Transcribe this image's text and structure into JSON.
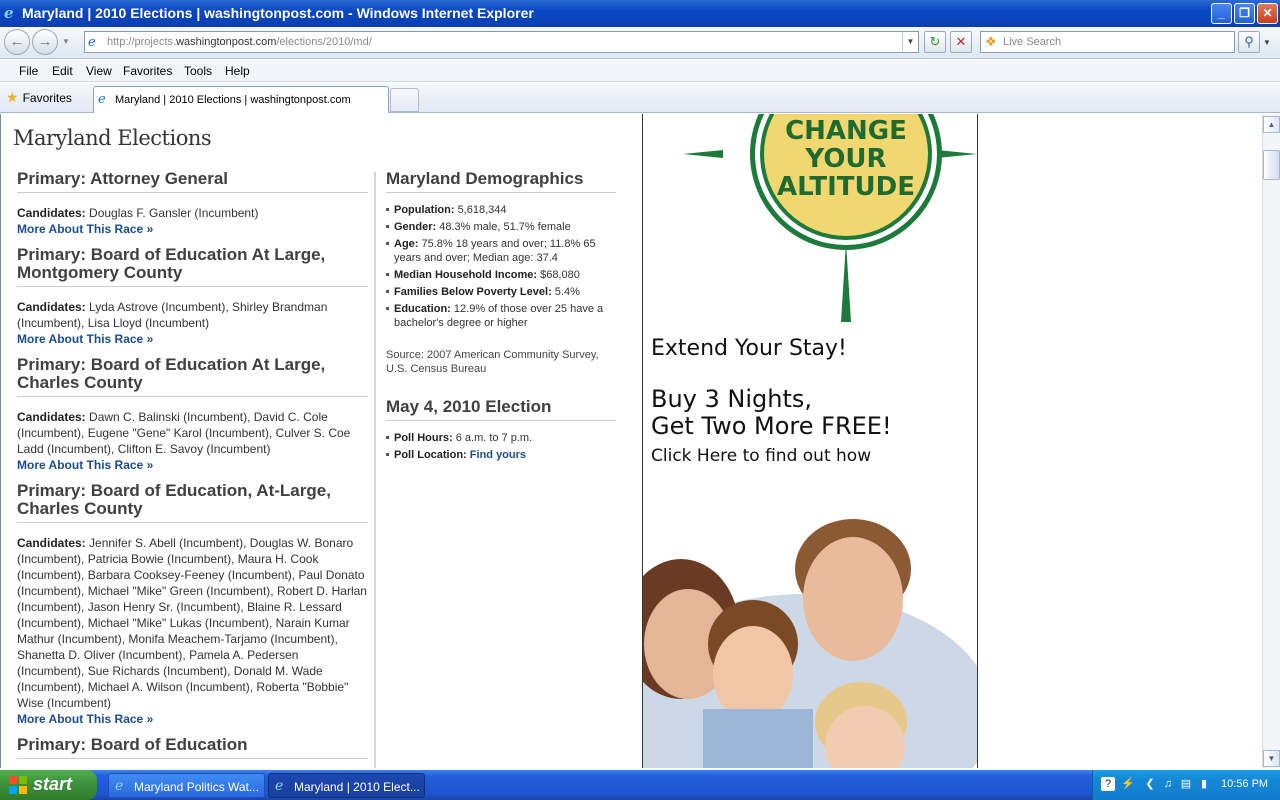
{
  "window": {
    "title": "Maryland | 2010 Elections | washingtonpost.com - Windows Internet Explorer",
    "minimize": "_",
    "maximize": "❐",
    "close": "✕"
  },
  "address_bar": {
    "url_prefix": "http://projects.",
    "url_domain": "washingtonpost.com",
    "url_path": "/elections/2010/md/",
    "search_placeholder": "Live Search"
  },
  "menu": [
    "File",
    "Edit",
    "View",
    "Favorites",
    "Tools",
    "Help"
  ],
  "favorites_label": "Favorites",
  "tab": {
    "title": "Maryland | 2010 Elections | washingtonpost.com"
  },
  "page": {
    "title": "Maryland Elections",
    "races": [
      {
        "heading": "Primary: Attorney General",
        "candidates_label": "Candidates:",
        "candidates": "Douglas F. Gansler (Incumbent)",
        "more_link": "More About This Race »"
      },
      {
        "heading": "Primary: Board of Education At Large, Montgomery County",
        "candidates_label": "Candidates:",
        "candidates": "Lyda Astrove (Incumbent), Shirley Brandman (Incumbent), Lisa Lloyd (Incumbent)",
        "more_link": "More About This Race »"
      },
      {
        "heading": "Primary: Board of Education At Large, Charles County",
        "candidates_label": "Candidates:",
        "candidates": "Dawn C. Balinski (Incumbent), David C. Cole (Incumbent), Eugene \"Gene\" Karol (Incumbent), Culver S. Coe Ladd (Incumbent), Clifton E. Savoy (Incumbent)",
        "more_link": "More About This Race »"
      },
      {
        "heading": "Primary: Board of Education, At-Large, Charles County",
        "candidates_label": "Candidates:",
        "candidates": "Jennifer S. Abell (Incumbent), Douglas W. Bonaro (Incumbent), Patricia Bowie (Incumbent), Maura H. Cook (Incumbent), Barbara Cooksey-Feeney (Incumbent), Paul Donato (Incumbent), Michael \"Mike\" Green (Incumbent), Robert D. Harlan (Incumbent), Jason Henry Sr. (Incumbent), Blaine R. Lessard (Incumbent), Michael \"Mike\" Lukas (Incumbent), Narain Kumar Mathur (Incumbent), Monifa Meachem-Tarjamo (Incumbent), Shanetta D. Oliver (Incumbent), Pamela A. Pedersen (Incumbent), Sue Richards (Incumbent), Donald M. Wade (Incumbent), Michael A. Wilson (Incumbent), Roberta \"Bobbie\" Wise (Incumbent)",
        "more_link": "More About This Race »"
      },
      {
        "heading": "Primary: Board of Education",
        "candidates_label": "",
        "candidates": "",
        "more_link": ""
      }
    ],
    "demographics": {
      "heading": "Maryland Demographics",
      "items": [
        {
          "label": "Population:",
          "value": "5,618,344"
        },
        {
          "label": "Gender:",
          "value": "48.3% male, 51.7% female"
        },
        {
          "label": "Age:",
          "value": "75.8% 18 years and over; 11.8% 65 years and over; Median age: 37.4"
        },
        {
          "label": "Median Household Income:",
          "value": "$68,080"
        },
        {
          "label": "Families Below Poverty Level:",
          "value": "5.4%"
        },
        {
          "label": "Education:",
          "value": "12.9% of those over 25 have a bachelor's degree or higher"
        }
      ],
      "source": "Source: 2007 American Community Survey, U.S. Census Bureau"
    },
    "election": {
      "heading": "May 4, 2010 Election",
      "poll_hours_label": "Poll Hours:",
      "poll_hours_value": "6 a.m. to 7 p.m.",
      "poll_location_label": "Poll Location:",
      "poll_location_link": "Find yours"
    }
  },
  "ad": {
    "compass_line1": "CHANGE",
    "compass_line2": "YOUR",
    "compass_line3": "ALTITUDE",
    "line1": "Extend Your Stay!",
    "line2": "Buy 3 Nights,",
    "line3": "Get Two More FREE!",
    "line4": "Click Here to find out how"
  },
  "taskbar": {
    "start": "start",
    "items": [
      "Maryland Politics Wat...",
      "Maryland | 2010 Elect..."
    ],
    "clock": "10:56 PM"
  }
}
